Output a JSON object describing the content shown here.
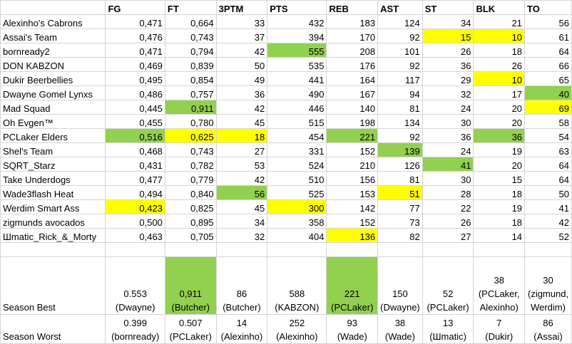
{
  "colors": {
    "best": "#92d050",
    "worst": "#ffff00",
    "grid": "#d4d4d4"
  },
  "columns": [
    "",
    "FG",
    "FT",
    "3PTM",
    "PTS",
    "REB",
    "AST",
    "ST",
    "BLK",
    "TO"
  ],
  "rows": [
    {
      "name": "Alexinho's Cabrons",
      "values": [
        "0,471",
        "0,664",
        "33",
        "432",
        "183",
        "124",
        "34",
        "21",
        "56"
      ],
      "marks": [
        "",
        "",
        "",
        "",
        "",
        "",
        "",
        "",
        ""
      ]
    },
    {
      "name": "Assai's Team",
      "values": [
        "0,476",
        "0,743",
        "37",
        "394",
        "170",
        "92",
        "15",
        "10",
        "61"
      ],
      "marks": [
        "",
        "",
        "",
        "",
        "",
        "",
        "y",
        "y",
        ""
      ]
    },
    {
      "name": "bornready2",
      "values": [
        "0,471",
        "0,794",
        "42",
        "555",
        "208",
        "101",
        "26",
        "18",
        "64"
      ],
      "marks": [
        "",
        "",
        "",
        "g",
        "",
        "",
        "",
        "",
        ""
      ]
    },
    {
      "name": "DON KABZON",
      "values": [
        "0,469",
        "0,839",
        "50",
        "535",
        "176",
        "92",
        "36",
        "26",
        "66"
      ],
      "marks": [
        "",
        "",
        "",
        "",
        "",
        "",
        "",
        "",
        ""
      ]
    },
    {
      "name": "Dukir Beerbellies",
      "values": [
        "0,495",
        "0,854",
        "49",
        "441",
        "164",
        "117",
        "29",
        "10",
        "65"
      ],
      "marks": [
        "",
        "",
        "",
        "",
        "",
        "",
        "",
        "y",
        ""
      ]
    },
    {
      "name": "Dwayne Gomel Lynxs",
      "values": [
        "0,486",
        "0,757",
        "36",
        "490",
        "167",
        "94",
        "32",
        "17",
        "40"
      ],
      "marks": [
        "",
        "",
        "",
        "",
        "",
        "",
        "",
        "",
        "g"
      ]
    },
    {
      "name": "Mad Squad",
      "values": [
        "0,445",
        "0,911",
        "42",
        "446",
        "140",
        "81",
        "24",
        "20",
        "69"
      ],
      "marks": [
        "",
        "g",
        "",
        "",
        "",
        "",
        "",
        "",
        "y"
      ]
    },
    {
      "name": "Oh Evgen™",
      "values": [
        "0,455",
        "0,780",
        "45",
        "515",
        "198",
        "134",
        "30",
        "20",
        "58"
      ],
      "marks": [
        "",
        "",
        "",
        "",
        "",
        "",
        "",
        "",
        ""
      ]
    },
    {
      "name": "PCLaker Elders",
      "values": [
        "0,516",
        "0,625",
        "18",
        "454",
        "221",
        "92",
        "36",
        "36",
        "54"
      ],
      "marks": [
        "g",
        "y",
        "y",
        "",
        "g",
        "",
        "",
        "g",
        ""
      ]
    },
    {
      "name": "Shel's Team",
      "values": [
        "0,468",
        "0,743",
        "27",
        "331",
        "152",
        "139",
        "24",
        "19",
        "63"
      ],
      "marks": [
        "",
        "",
        "",
        "",
        "",
        "g",
        "",
        "",
        ""
      ]
    },
    {
      "name": "SQRT_Starz",
      "values": [
        "0,431",
        "0,782",
        "53",
        "524",
        "210",
        "126",
        "41",
        "20",
        "64"
      ],
      "marks": [
        "",
        "",
        "",
        "",
        "",
        "",
        "g",
        "",
        ""
      ]
    },
    {
      "name": "Take Underdogs",
      "values": [
        "0,477",
        "0,779",
        "42",
        "510",
        "156",
        "81",
        "30",
        "15",
        "64"
      ],
      "marks": [
        "",
        "",
        "",
        "",
        "",
        "",
        "",
        "",
        ""
      ]
    },
    {
      "name": "Wade3flash Heat",
      "values": [
        "0,494",
        "0,840",
        "56",
        "525",
        "153",
        "51",
        "28",
        "18",
        "50"
      ],
      "marks": [
        "",
        "",
        "g",
        "",
        "",
        "y",
        "",
        "",
        ""
      ]
    },
    {
      "name": "Werdim Smart Ass",
      "values": [
        "0,423",
        "0,825",
        "45",
        "300",
        "142",
        "77",
        "22",
        "19",
        "41"
      ],
      "marks": [
        "y",
        "",
        "",
        "y",
        "",
        "",
        "",
        "",
        ""
      ]
    },
    {
      "name": "zigmunds avocados",
      "values": [
        "0,500",
        "0,895",
        "34",
        "358",
        "152",
        "73",
        "26",
        "18",
        "42"
      ],
      "marks": [
        "",
        "",
        "",
        "",
        "",
        "",
        "",
        "",
        ""
      ]
    },
    {
      "name": "Шmatic_Rick_&_Morty",
      "values": [
        "0,463",
        "0,705",
        "32",
        "404",
        "136",
        "82",
        "27",
        "14",
        "52"
      ],
      "marks": [
        "",
        "",
        "",
        "",
        "y",
        "",
        "",
        "",
        ""
      ]
    }
  ],
  "season_best": {
    "label": "Season Best",
    "cells": [
      {
        "value": "0.553",
        "who": "(Dwayne)",
        "mark": ""
      },
      {
        "value": "0,911",
        "who": "(Butcher)",
        "mark": "g"
      },
      {
        "value": "86",
        "who": "(Butcher)",
        "mark": ""
      },
      {
        "value": "588",
        "who": "(KABZON)",
        "mark": ""
      },
      {
        "value": "221",
        "who": "(PCLaker)",
        "mark": "g"
      },
      {
        "value": "150",
        "who": "(Dwayne)",
        "mark": ""
      },
      {
        "value": "52",
        "who": "(PCLaker)",
        "mark": ""
      },
      {
        "value": "38",
        "who": "(PCLaker, Alexinho)",
        "mark": ""
      },
      {
        "value": "30",
        "who": "(zigmund, Werdim)",
        "mark": ""
      }
    ]
  },
  "season_worst": {
    "label": "Season Worst",
    "cells": [
      {
        "value": "0.399",
        "who": "(bornready)"
      },
      {
        "value": "0.507",
        "who": "(PCLaker)"
      },
      {
        "value": "14",
        "who": "(Alexinho)"
      },
      {
        "value": "252",
        "who": "(Alexinho)"
      },
      {
        "value": "93",
        "who": "(Wade)"
      },
      {
        "value": "38",
        "who": "(Wade)"
      },
      {
        "value": "13",
        "who": "(Шmatic)"
      },
      {
        "value": "7",
        "who": "(Dukir)"
      },
      {
        "value": "86",
        "who": "(Assai)"
      }
    ]
  }
}
